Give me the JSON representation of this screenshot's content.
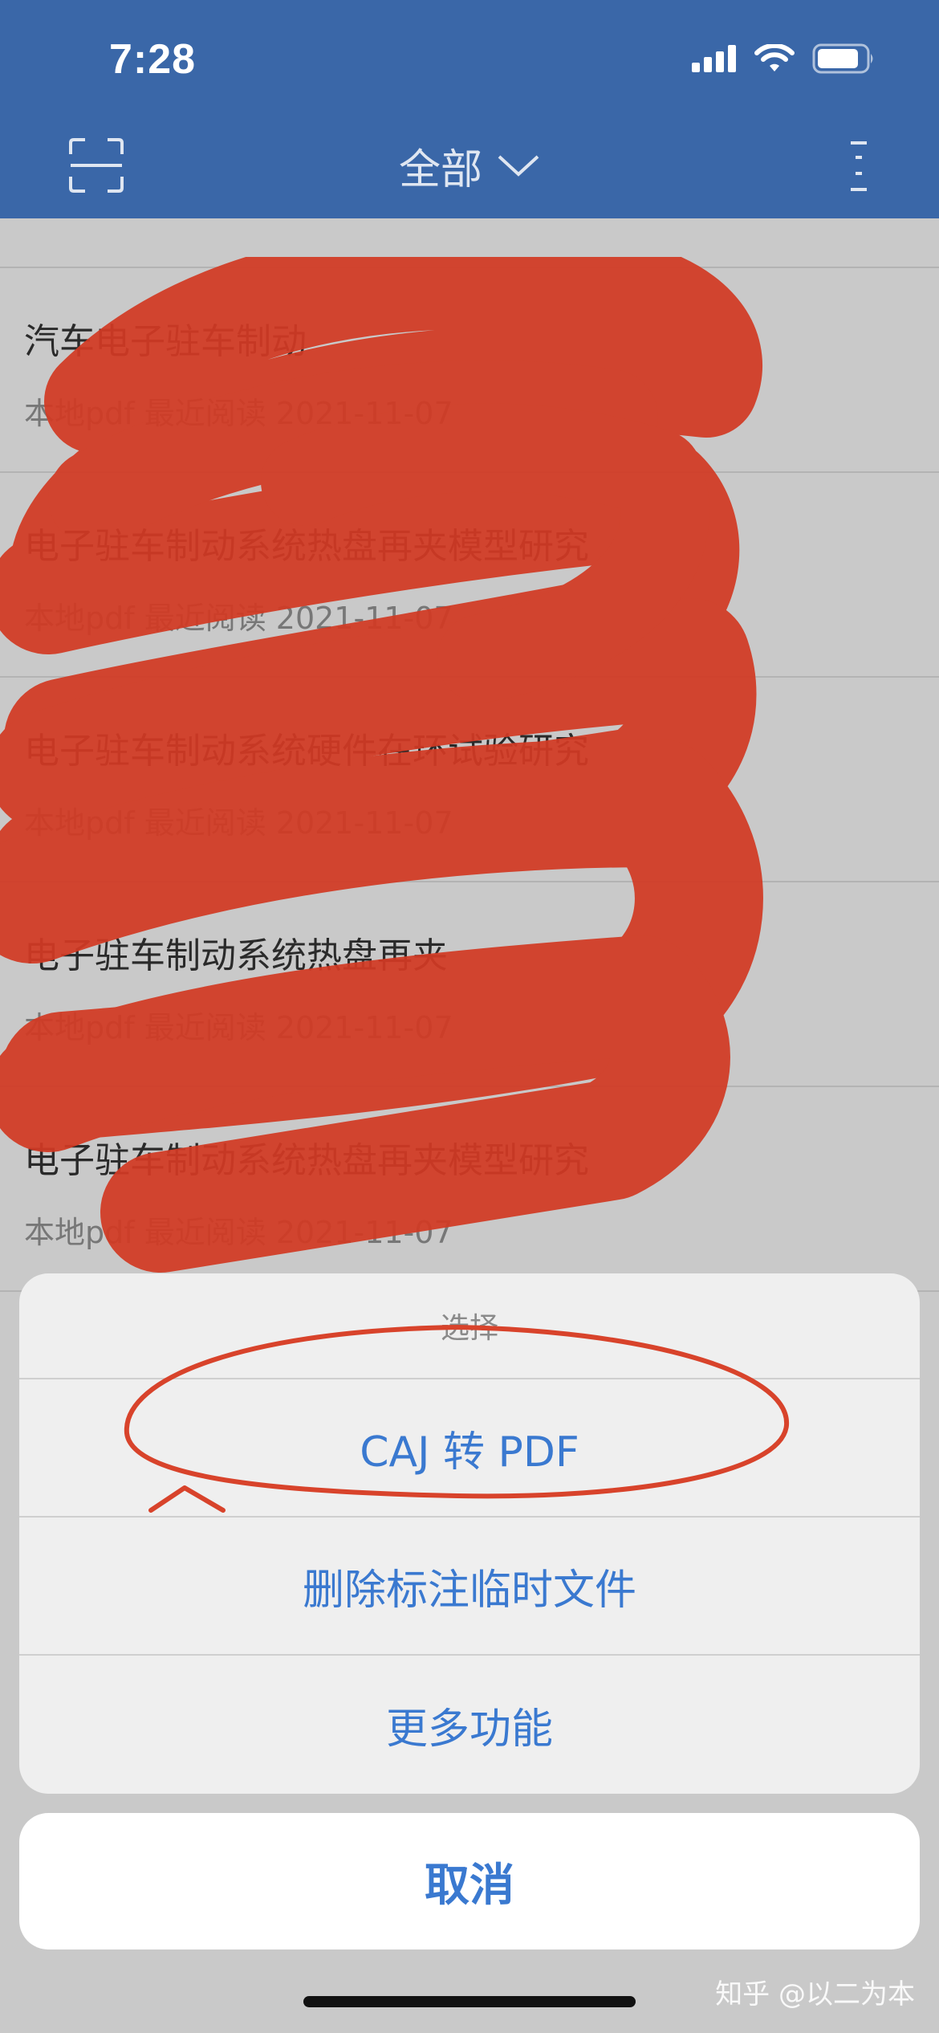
{
  "status": {
    "time": "7:28",
    "icons": [
      "cellular-signal-icon",
      "wifi-icon",
      "battery-icon"
    ]
  },
  "nav": {
    "title": "全部",
    "left_icon": "scan-icon",
    "right_icon": "more-vertical-icon"
  },
  "list": {
    "items": [
      {
        "title": "汽车电子驻车制动",
        "meta": "本地pdf 最近阅读 2021-11-07"
      },
      {
        "title": "电子驻车制动系统热盘再夹模型研究",
        "meta": "本地pdf 最近阅读 2021-11-07"
      },
      {
        "title": "电子驻车制动系统硬件在环试验研究",
        "meta": "本地pdf 最近阅读 2021-11-07"
      },
      {
        "title": "电子驻车制动系统热盘再夹",
        "meta": "本地pdf 最近阅读 2021-11-07"
      },
      {
        "title": "电子驻车制动系统热盘再夹模型研究",
        "meta": "本地pdf 最近阅读 2021-11-07"
      }
    ]
  },
  "sheet": {
    "title": "选择",
    "actions": [
      "CAJ 转 PDF",
      "删除标注临时文件",
      "更多功能"
    ],
    "cancel": "取消"
  },
  "watermark": "知乎 @以二为本",
  "colors": {
    "header_bg": "#3a67a8",
    "action_blue": "#3a79d0",
    "redaction_red": "#d23a24"
  }
}
